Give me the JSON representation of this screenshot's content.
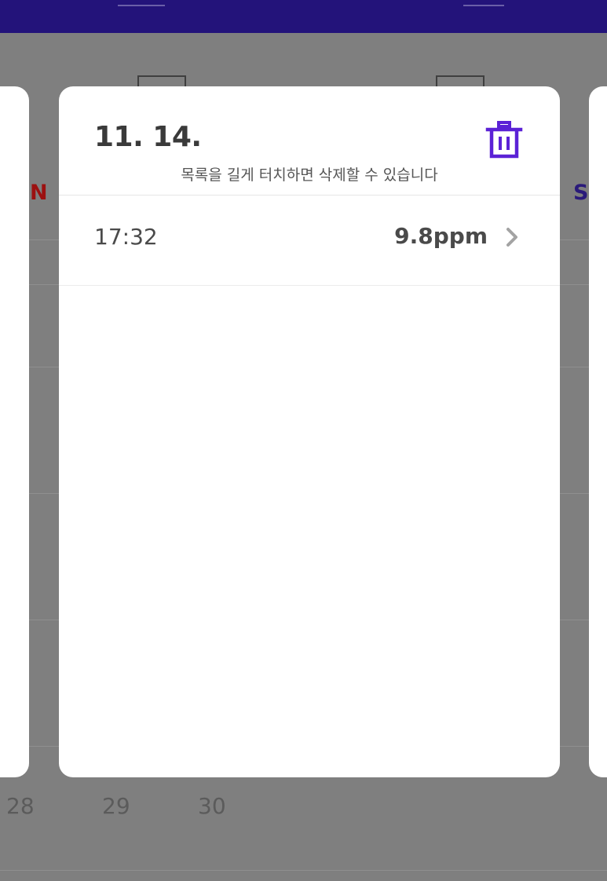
{
  "background_calendar": {
    "day_of_week_sun": "N",
    "day_of_week_sat": "S",
    "bottom_days": [
      "28",
      "29",
      "30"
    ]
  },
  "modal": {
    "date": "11. 14.",
    "hint": "목록을 길게 터치하면 삭제할 수 있습니다",
    "delete_icon": "trash-icon",
    "accent_color": "#5b22d6",
    "records": [
      {
        "time": "17:32",
        "value": "9.8ppm"
      }
    ]
  }
}
